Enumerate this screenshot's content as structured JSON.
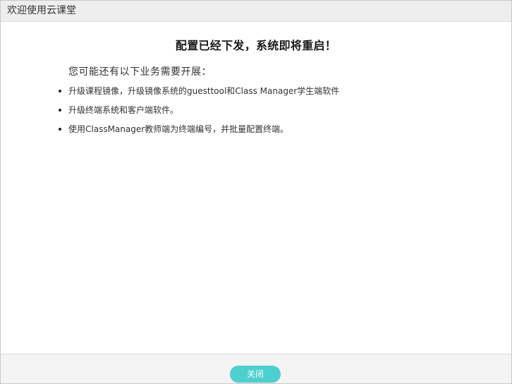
{
  "window": {
    "title": "欢迎使用云课堂"
  },
  "main": {
    "headline": "配置已经下发，系统即将重启！",
    "intro": "您可能还有以下业务需要开展：",
    "tasks": [
      {
        "text": "升级课程镜像，升级镜像系统的guesttool和Class Manager学生端软件"
      },
      {
        "text": "升级终端系统和客户端软件。"
      },
      {
        "text": "使用ClassManager教师端为终端编号，并批量配置终端。"
      }
    ]
  },
  "footer": {
    "close_label": "关闭"
  },
  "colors": {
    "accent": "#4ecfcf",
    "titlebar_bg": "#eeeeee",
    "footer_bg": "#f4f4f4"
  }
}
